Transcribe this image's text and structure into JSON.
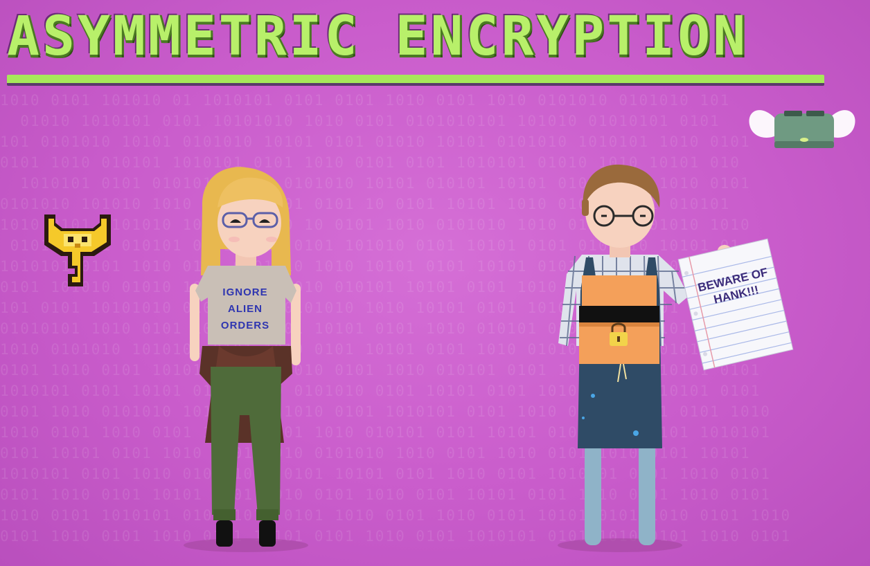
{
  "title": "ASYMMETRIC ENCRYPTION",
  "shirt_text": [
    "IGNORE",
    "ALIEN",
    "ORDERS"
  ],
  "note_text": [
    "BEWARE OF",
    "HANK!!!"
  ],
  "colors": {
    "background": "#c95ccb",
    "title": "#b8f06a",
    "title_rule": "#a7e85a"
  },
  "icons": [
    "key-icon",
    "winged-toaster-icon",
    "padlock-icon"
  ]
}
